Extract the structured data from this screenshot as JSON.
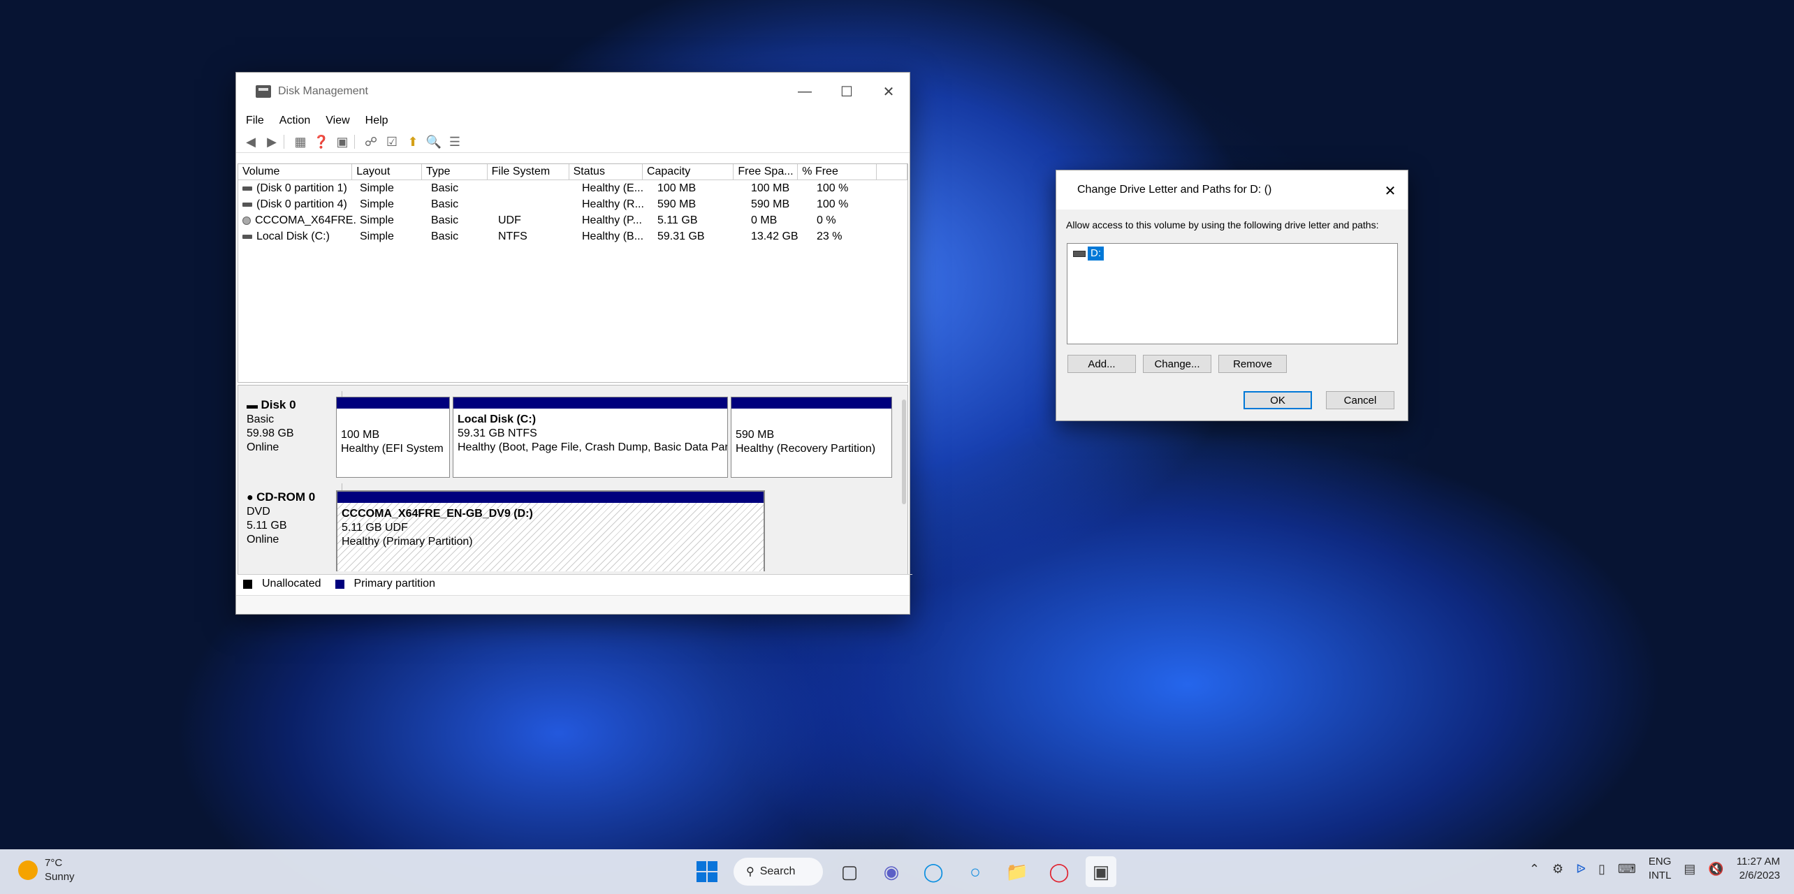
{
  "window": {
    "title": "Disk Management",
    "menu": [
      "File",
      "Action",
      "View",
      "Help"
    ]
  },
  "volume_list": {
    "columns": [
      "Volume",
      "Layout",
      "Type",
      "File System",
      "Status",
      "Capacity",
      "Free Spa...",
      "% Free"
    ],
    "rows": [
      {
        "volume": "(Disk 0 partition 1)",
        "layout": "Simple",
        "type": "Basic",
        "fs": "",
        "status": "Healthy (E...",
        "capacity": "100 MB",
        "free": "100 MB",
        "pct": "100 %"
      },
      {
        "volume": "(Disk 0 partition 4)",
        "layout": "Simple",
        "type": "Basic",
        "fs": "",
        "status": "Healthy (R...",
        "capacity": "590 MB",
        "free": "590 MB",
        "pct": "100 %"
      },
      {
        "volume": "CCCOMA_X64FRE...",
        "layout": "Simple",
        "type": "Basic",
        "fs": "UDF",
        "status": "Healthy (P...",
        "capacity": "5.11 GB",
        "free": "0 MB",
        "pct": "0 %"
      },
      {
        "volume": "Local Disk  (C:)",
        "layout": "Simple",
        "type": "Basic",
        "fs": "NTFS",
        "status": "Healthy (B...",
        "capacity": "59.31 GB",
        "free": "13.42 GB",
        "pct": "23 %"
      }
    ]
  },
  "disks": {
    "disk0": {
      "name": "Disk 0",
      "kind": "Basic",
      "size": "59.98 GB",
      "state": "Online",
      "p1": {
        "size": "100 MB",
        "status": "Healthy (EFI System"
      },
      "p2": {
        "name": "Local Disk  (C:)",
        "size": "59.31 GB NTFS",
        "status": "Healthy (Boot, Page File, Crash Dump, Basic Data Part"
      },
      "p3": {
        "size": "590 MB",
        "status": "Healthy (Recovery Partition)"
      }
    },
    "cdrom0": {
      "name": "CD-ROM 0",
      "kind": "DVD",
      "size": "5.11 GB",
      "state": "Online",
      "p1": {
        "name": "CCCOMA_X64FRE_EN-GB_DV9  (D:)",
        "size": "5.11 GB UDF",
        "status": "Healthy (Primary Partition)"
      }
    }
  },
  "legend": {
    "unallocated": "Unallocated",
    "primary": "Primary partition"
  },
  "dialog": {
    "title": "Change Drive Letter and Paths for D: ()",
    "prompt": "Allow access to this volume by using the following drive letter and paths:",
    "item": "D:",
    "add": "Add...",
    "change": "Change...",
    "remove": "Remove",
    "ok": "OK",
    "cancel": "Cancel"
  },
  "taskbar": {
    "temp": "7°C",
    "weather": "Sunny",
    "search": "Search",
    "lang1": "ENG",
    "lang2": "INTL",
    "time": "11:27 AM",
    "date": "2/6/2023"
  },
  "colors": {
    "primary_partition": "#00007d",
    "accent": "#0078d7"
  }
}
